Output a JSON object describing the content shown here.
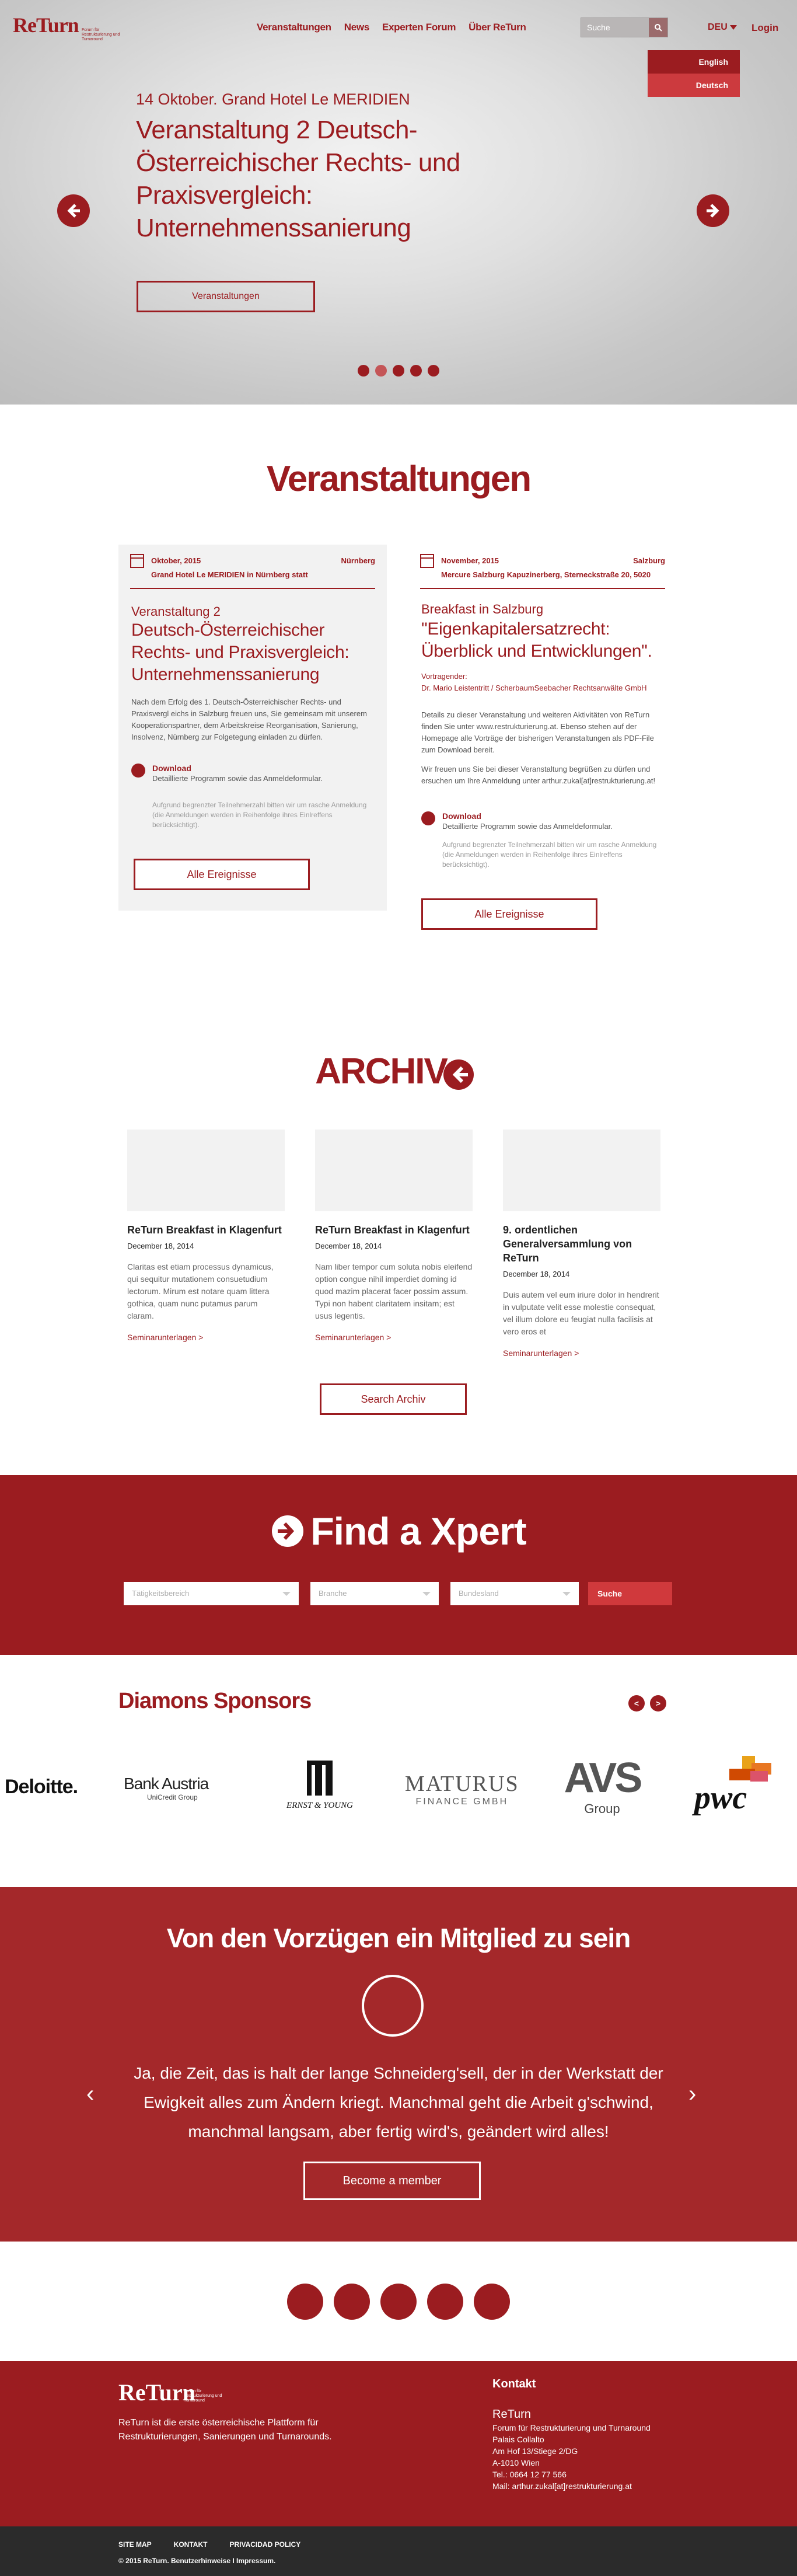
{
  "header": {
    "logo": "ReTurn",
    "logo_tagline": "Forum für Restrukturierung und Turnaround",
    "nav": [
      "Veranstaltungen",
      "News",
      "Experten Forum",
      "Über ReTurn"
    ],
    "search_placeholder": "Suche",
    "language": "DEU",
    "language_options": [
      "English",
      "Deutsch"
    ],
    "login": "Login"
  },
  "hero": {
    "date": "14 Oktober.",
    "venue": "Grand Hotel Le MERIDIEN",
    "title": "Veranstaltung 2 Deutsch-Österreichischer Rechts- und Praxisvergleich: Unternehmenssanierung",
    "button": "Veranstaltungen",
    "slides": 5
  },
  "events": {
    "title": "Veranstaltungen",
    "cards": [
      {
        "month": "Oktober, 2015",
        "city": "Nürnberg",
        "venue": "Grand Hotel Le MERIDIEN  in Nürnberg statt",
        "type": "Veranstaltung 2",
        "title": "Deutsch-Österreichischer Rechts- und Praxisvergleich: Unternehmenssanierung",
        "text": "Nach dem Erfolg des 1. Deutsch-Österreichischer Rechts- und Praxisvergl eichs in Salzburg freuen uns, Sie gemeinsam mit unserem Kooperationspartner, dem Arbeitskreise Reorganisation, Sanierung, Insolvenz, Nürnberg zur Folgetegung einladen zu dürfen.",
        "download_title": "Download",
        "download_text": "Detaillierte Programm sowie das Anmeldeformular.",
        "note": "Aufgrund begrenzter Teilnehmerzahl bitten wir um rasche Anmeldung (die Anmeldungen werden in Reihenfolge ihres Einlreffens berücksichtigt)."
      },
      {
        "month": "November, 2015",
        "city": "Salzburg",
        "venue": "Mercure Salzburg Kapuzinerberg, Sterneckstraße 20, 5020",
        "type": "Breakfast in Salzburg",
        "title": "\"Eigenkapitalersatzrecht: Überblick und Entwicklungen\".",
        "speaker_label": "Vortragender:",
        "speaker": "Dr. Mario Leistentritt / ScherbaumSeebacher Rechtsanwälte GmbH",
        "text": "Details zu dieser Veranstaltung und weiteren Aktivitäten von ReTurn finden Sie unter www.restrukturierung.at. Ebenso stehen auf der Homepage alle Vorträge der bisherigen Veranstaltungen als PDF-File zum Download bereit.",
        "text2": "Wir freuen uns Sie bei dieser Veranstaltung begrüßen zu dürfen und ersuchen um Ihre Anmeldung unter arthur.zukal[at]restrukturierung.at!",
        "download_title": "Download",
        "download_text": "Detaillierte Programm sowie das Anmeldeformular.",
        "note": "Aufgrund begrenzter Teilnehmerzahl bitten wir um rasche Anmeldung (die Anmeldungen werden in Reihenfolge ihres Einlreffens berücksichtigt)."
      }
    ],
    "button": "Alle Ereignisse"
  },
  "archiv": {
    "title": "ARCHIV",
    "cards": [
      {
        "title": "ReTurn Breakfast in Klagenfurt",
        "date": "December 18, 2014",
        "text": "Claritas est etiam processus dynamicus, qui sequitur mutationem consuetudium lectorum. Mirum est notare quam littera gothica, quam nunc putamus parum claram.",
        "link": "Seminarunterlagen >"
      },
      {
        "title": "ReTurn Breakfast in Klagenfurt",
        "date": "December 18, 2014",
        "text": "Nam liber tempor cum soluta nobis eleifend option congue nihil imperdiet doming id quod mazim placerat facer possim assum. Typi non habent claritatem insitam; est usus legentis.",
        "link": "Seminarunterlagen >"
      },
      {
        "title": "9. ordentlichen Generalversammlung von ReTurn",
        "date": "December 18, 2014",
        "text": "Duis autem vel eum iriure dolor in hendrerit in vulputate velit esse molestie consequat, vel illum dolore eu feugiat nulla facilisis at vero eros et",
        "link": "Seminarunterlagen >"
      }
    ],
    "button": "Search Archiv"
  },
  "xpert": {
    "title": "Find a Xpert",
    "selects": [
      "Tätigkeitsbereich",
      "Branche",
      "Bundesland"
    ],
    "button": "Suche"
  },
  "sponsors": {
    "title": "Diamons Sponsors",
    "logos": [
      "Deloitte.",
      "Bank Austria",
      "UniCredit Group",
      "ERNST & YOUNG",
      "MATURUS",
      "FINANCE GMBH",
      "AVS",
      "Group",
      "pwc"
    ]
  },
  "member": {
    "title": "Von den Vorzügen ein Mitglied zu sein",
    "quote": "Ja, die Zeit, das is halt der lange Schneiderg'sell, der in der Werkstatt der Ewigkeit alles zum Ändern kriegt. Manchmal geht die Arbeit g'schwind, manchmal langsam, aber fertig wird's, geändert wird alles!",
    "button": "Become a member"
  },
  "footer": {
    "logo": "ReTurn",
    "tagline": "Forum für Restrukturierung und Turnaround",
    "desc": "ReTurn ist die erste österreichische Plattform für Restrukturierungen, Sanierungen und Turnarounds.",
    "contact_title": "Kontakt",
    "contact_name": "ReTurn",
    "contact_lines": [
      "Forum für Restrukturierung und Turnaround",
      "Palais Collalto",
      "Am Hof 13/Stiege 2/DG",
      "A-1010 Wien",
      "Tel.: 0664 12 77 566",
      "Mail: arthur.zukal[at]restrukturierung.at"
    ],
    "links": [
      "SITE MAP",
      "KONTAKT",
      "PRIVACIDAD POLICY"
    ],
    "copyright": "© 2015 ReTurn. Benutzerhinweise I Impressum."
  }
}
